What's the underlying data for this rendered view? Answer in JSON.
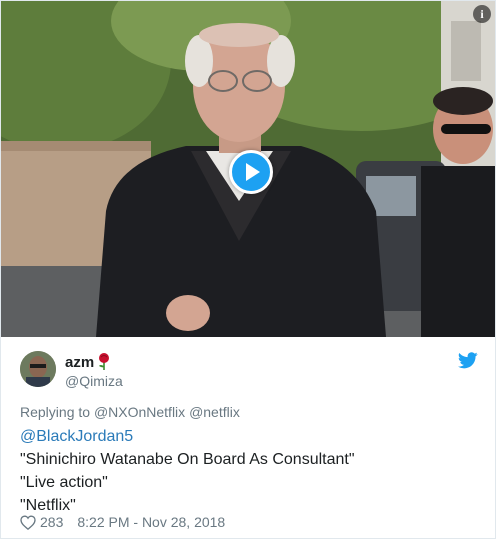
{
  "media": {
    "info_glyph": "i",
    "play_icon": "play-icon"
  },
  "author": {
    "display_name": "azm",
    "name_emoji": "rose-icon",
    "handle": "@Qimiza"
  },
  "reply": {
    "prefix": "Replying to",
    "to_1": "@NXOnNetflix",
    "to_2": "@netflix"
  },
  "tweet": {
    "lines": [
      "@BlackJordan5",
      "\"Shinichiro Watanabe On Board As Consultant\"",
      "\"Live action\"",
      "\"Netflix\""
    ]
  },
  "footer": {
    "like_count": "283",
    "timestamp": "8:22 PM - Nov 28, 2018"
  },
  "colors": {
    "twitter_blue": "#1da1f2",
    "link": "#2b7bb9",
    "muted": "#697882"
  }
}
